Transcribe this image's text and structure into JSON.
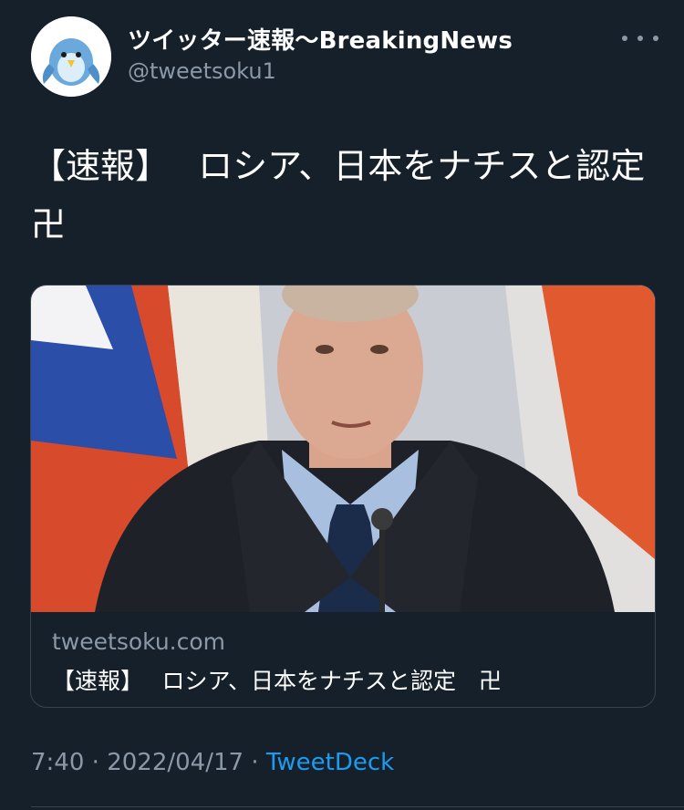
{
  "tweet": {
    "author_name": "ツイッター速報〜BreakingNews",
    "author_handle": "@tweetsoku1",
    "text": "【速報】　 ロシア、日本をナチスと認定　卍",
    "time": "7:40",
    "date": "2022/04/17",
    "source": "TweetDeck",
    "separator": "·"
  },
  "link_card": {
    "domain": "tweetsoku.com",
    "title": "【速報】　 ロシア、日本をナチスと認定　卍"
  },
  "icons": {
    "avatar": "bird-avatar-icon",
    "more": "more-options-icon"
  },
  "colors": {
    "background": "#15202b",
    "text": "#ffffff",
    "muted_text": "#8b98a5",
    "link": "#1d9bf0",
    "border": "#38444d"
  }
}
